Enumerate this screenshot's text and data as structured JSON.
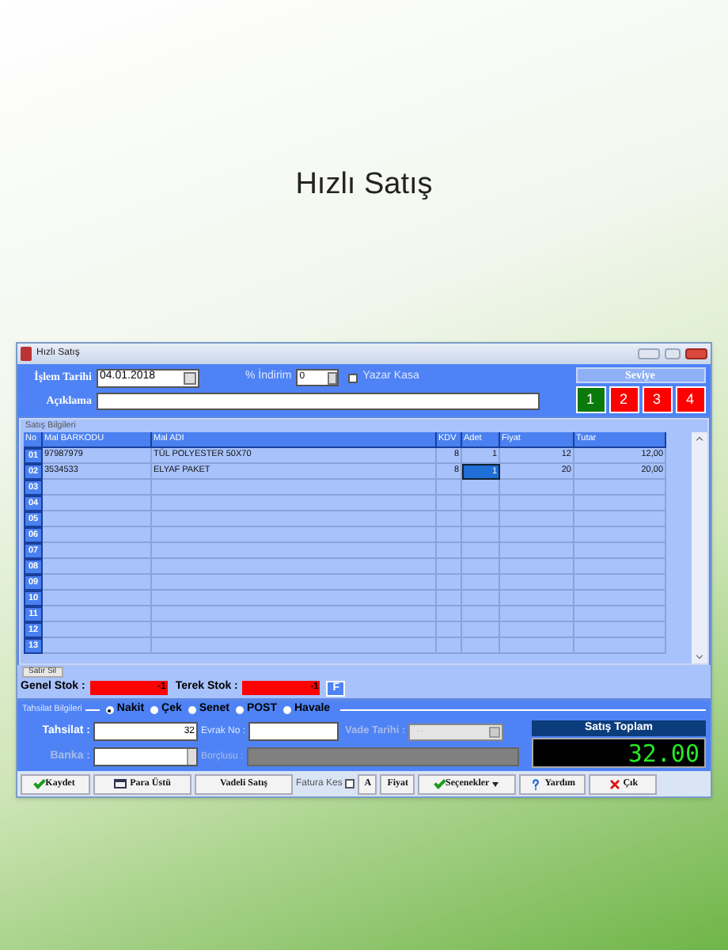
{
  "page_title": "Hızlı Satış",
  "window": {
    "title": "Hızlı Satış"
  },
  "header": {
    "date_label": "İşlem Tarihi",
    "date": "04.01.2018",
    "discount_label": "% İndirim",
    "discount": "0",
    "cash_register": {
      "label": "Yazar Kasa",
      "checked": false
    },
    "note_label": "Açıklama",
    "level_title": "Seviye",
    "levels": [
      {
        "label": "1",
        "color": "#0a7a0a"
      },
      {
        "label": "2",
        "color": "#ff0000"
      },
      {
        "label": "3",
        "color": "#ff0000"
      },
      {
        "label": "4",
        "color": "#ff0000"
      }
    ]
  },
  "sales": {
    "group_title": "Satış Bilgileri",
    "columns": [
      "No",
      "Mal BARKODU",
      "Mal ADI",
      "KDV",
      "Adet",
      "Fiyat",
      "Tutar"
    ],
    "rows": [
      {
        "no": "01",
        "cells": [
          {
            "text": "97987979",
            "selected": false
          },
          {
            "text": "TÜL POLYESTER 50X70",
            "selected": false
          },
          {
            "text": "8",
            "selected": false
          },
          {
            "text": "1",
            "selected": false
          },
          {
            "text": "12",
            "selected": false
          },
          {
            "text": "12,00",
            "selected": false
          }
        ]
      },
      {
        "no": "02",
        "cells": [
          {
            "text": "3534533",
            "selected": false
          },
          {
            "text": "ELYAF PAKET",
            "selected": false
          },
          {
            "text": "8",
            "selected": false
          },
          {
            "text": "1",
            "selected": true
          },
          {
            "text": "20",
            "selected": false
          },
          {
            "text": "20,00",
            "selected": false
          }
        ]
      },
      {
        "no": "03"
      },
      {
        "no": "04"
      },
      {
        "no": "05"
      },
      {
        "no": "06"
      },
      {
        "no": "07"
      },
      {
        "no": "08"
      },
      {
        "no": "09"
      },
      {
        "no": "10"
      },
      {
        "no": "11"
      },
      {
        "no": "12"
      },
      {
        "no": "13"
      }
    ],
    "delete_row": "Satır Sil"
  },
  "stock": {
    "general_label": "Genel Stok :",
    "general": "-1",
    "warehouse_label": "Terek Stok :",
    "warehouse": "-1",
    "button": "F"
  },
  "payment": {
    "group_title": "Tahsilat Bilgileri",
    "methods": [
      {
        "label": "Nakit",
        "selected": true
      },
      {
        "label": "Çek",
        "selected": false
      },
      {
        "label": "Senet",
        "selected": false
      },
      {
        "label": "POST",
        "selected": false
      },
      {
        "label": "Havale",
        "selected": false
      }
    ],
    "amount_label": "Tahsilat :",
    "amount": "32",
    "doc_label": "Evrak No :",
    "due_label": "Vade Tarihi :",
    "due": ". .",
    "bank_label": "Banka :",
    "debtor_label": "Borçlusu :",
    "fields_disabled": true,
    "total_title": "Satış Toplam",
    "total": "32.00"
  },
  "toolbar": [
    {
      "kind": "check",
      "label": "Kaydet"
    },
    {
      "kind": "window",
      "label": "Para Üstü"
    },
    {
      "kind": "plain",
      "label": "Vadeli Satış"
    },
    {
      "kind": "checkbox",
      "label": "Fatura Kes",
      "checked": false
    },
    {
      "kind": "plain",
      "label": "A"
    },
    {
      "kind": "plain",
      "label": "Fiyat"
    },
    {
      "kind": "menu",
      "label": "Seçenekler"
    },
    {
      "kind": "help",
      "label": "Yardım"
    },
    {
      "kind": "cross",
      "label": "Çık"
    }
  ]
}
